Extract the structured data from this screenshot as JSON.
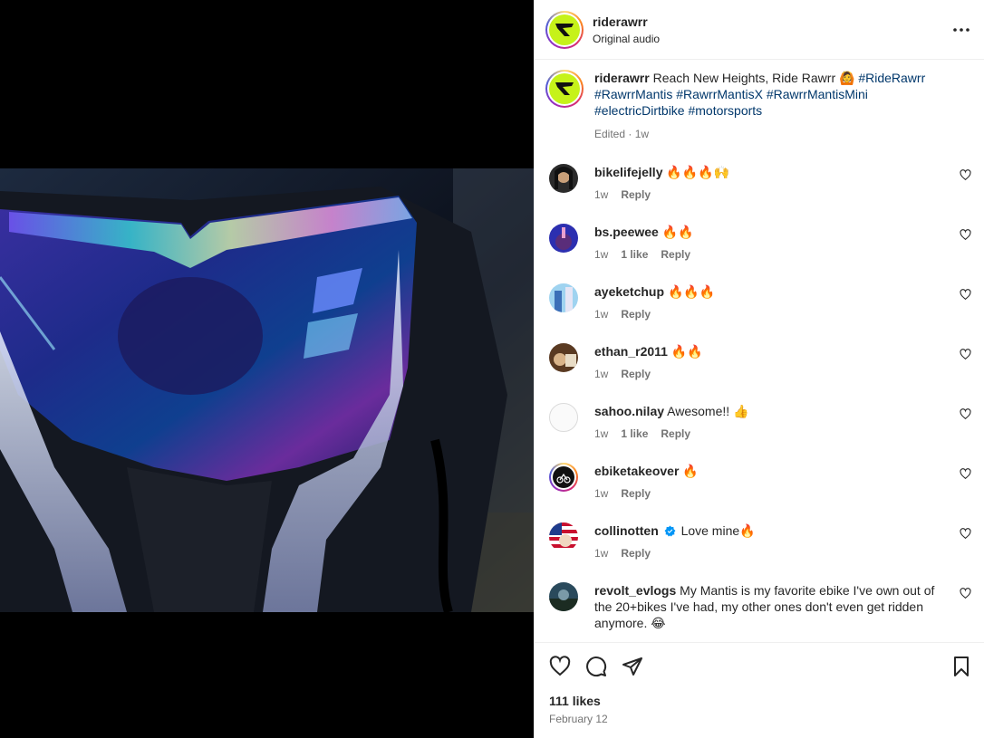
{
  "post": {
    "username": "riderawrr",
    "audio": "Original audio",
    "caption_text": "Reach New Heights, Ride Rawrr 🙆",
    "hashtags": [
      "#RideRawrr",
      "#RawrrMantis",
      "#RawrrMantisX",
      "#RawrrMantisMini",
      "#electricDirtbike",
      "#motorsports"
    ],
    "caption_meta": "Edited · 1w"
  },
  "comments": [
    {
      "user": "bikelifejelly",
      "text": "🔥🔥🔥🙌",
      "time": "1w",
      "likes": "",
      "reply": "Reply"
    },
    {
      "user": "bs.peewee",
      "text": "🔥🔥",
      "time": "1w",
      "likes": "1 like",
      "reply": "Reply"
    },
    {
      "user": "ayeketchup",
      "text": "🔥🔥🔥",
      "time": "1w",
      "likes": "",
      "reply": "Reply"
    },
    {
      "user": "ethan_r2011",
      "text": "🔥🔥",
      "time": "1w",
      "likes": "",
      "reply": "Reply"
    },
    {
      "user": "sahoo.nilay",
      "text": "Awesome!! 👍",
      "time": "1w",
      "likes": "1 like",
      "reply": "Reply"
    },
    {
      "user": "ebiketakeover",
      "text": "🔥",
      "time": "1w",
      "likes": "",
      "reply": "Reply"
    },
    {
      "user": "collinotten",
      "text": "Love mine🔥",
      "time": "1w",
      "likes": "",
      "reply": "Reply"
    },
    {
      "user": "revolt_evlogs",
      "text": "My Mantis is my favorite ebike I've own out of the 20+bikes I've had, my other ones don't even get ridden anymore. 😂",
      "time": "",
      "likes": "",
      "reply": ""
    }
  ],
  "footer": {
    "likes": "111 likes",
    "date": "February 12"
  },
  "colors": {
    "brand_lime": "#c6f21a",
    "hashtag": "#00376b",
    "verified": "#0095f6",
    "muted_text": "#737373"
  },
  "icons": [
    "volume-mute-icon",
    "more-options-icon",
    "heart-icon",
    "comment-icon",
    "share-icon",
    "bookmark-icon",
    "verified-badge-icon"
  ]
}
